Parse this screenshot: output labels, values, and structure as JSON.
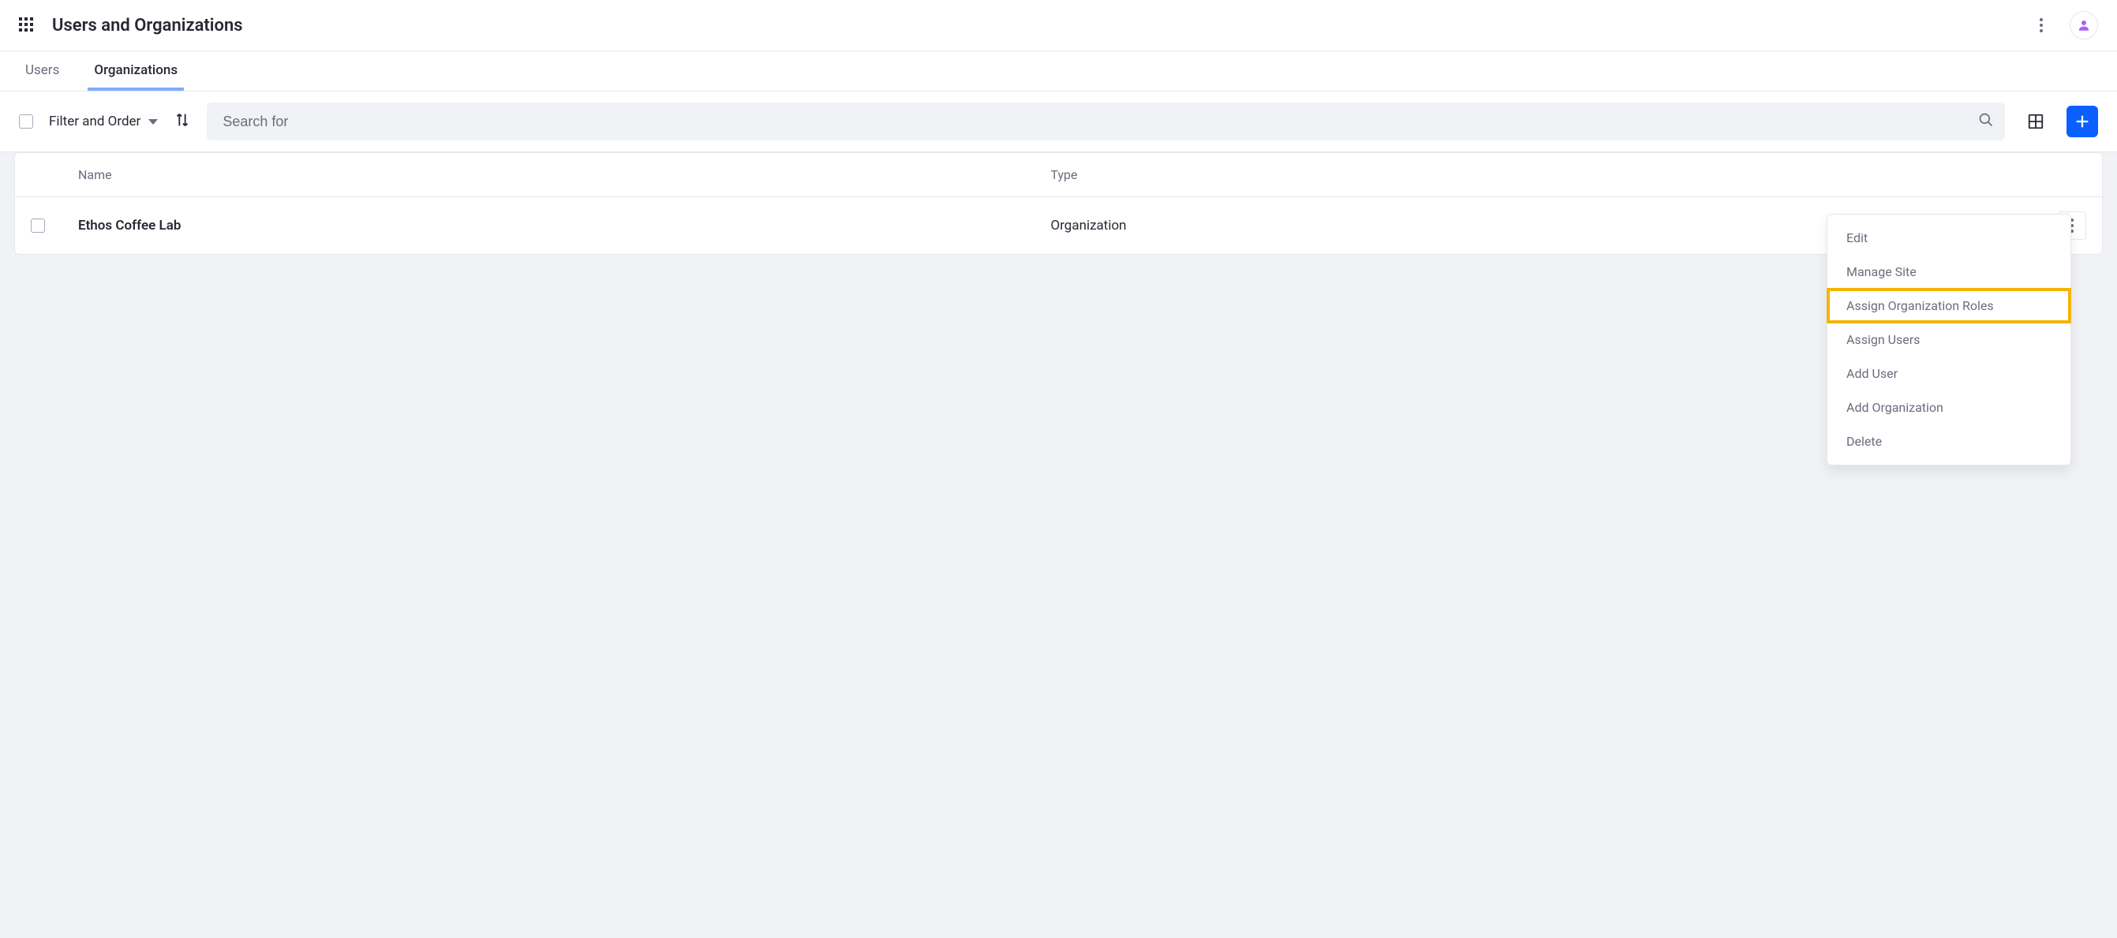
{
  "header": {
    "title": "Users and Organizations"
  },
  "tabs": [
    {
      "label": "Users",
      "active": false
    },
    {
      "label": "Organizations",
      "active": true
    }
  ],
  "toolbar": {
    "filter_label": "Filter and Order",
    "search_placeholder": "Search for"
  },
  "table": {
    "columns": {
      "name": "Name",
      "type": "Type"
    },
    "rows": [
      {
        "name": "Ethos Coffee Lab",
        "type": "Organization"
      }
    ]
  },
  "row_menu": {
    "items": [
      {
        "label": "Edit",
        "highlighted": false
      },
      {
        "label": "Manage Site",
        "highlighted": false
      },
      {
        "label": "Assign Organization Roles",
        "highlighted": true
      },
      {
        "label": "Assign Users",
        "highlighted": false
      },
      {
        "label": "Add User",
        "highlighted": false
      },
      {
        "label": "Add Organization",
        "highlighted": false
      },
      {
        "label": "Delete",
        "highlighted": false
      }
    ]
  },
  "colors": {
    "primary": "#0b5fff",
    "highlight": "#f5b400",
    "avatar": "#a960ff"
  }
}
